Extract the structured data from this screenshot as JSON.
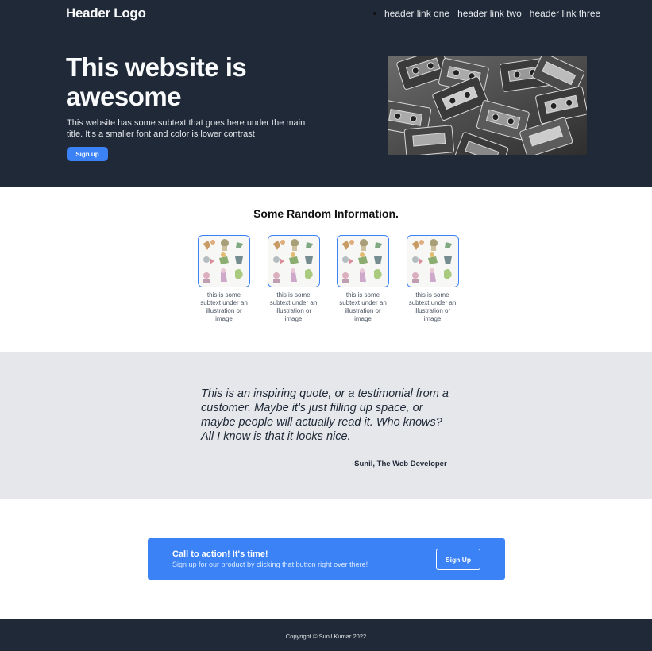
{
  "header": {
    "logo": "Header Logo",
    "nav": [
      "header link one",
      "header link two",
      "header link three"
    ]
  },
  "hero": {
    "title": "This website is awesome",
    "subtext": "This website has some subtext that goes here under the main title. It's a smaller font and color is lower contrast",
    "button_label": "Sign up",
    "image_icon": "cassette-tapes-photo"
  },
  "info": {
    "title": "Some Random Information.",
    "cards": [
      {
        "text": "this is some subtext under an illustration or image",
        "icon": "animals-illustration"
      },
      {
        "text": "this is some subtext under an illustration or image",
        "icon": "animals-illustration"
      },
      {
        "text": "this is some subtext under an illustration or image",
        "icon": "animals-illustration"
      },
      {
        "text": "this is some subtext under an illustration or image",
        "icon": "animals-illustration"
      }
    ]
  },
  "quote": {
    "text": "This is an inspiring quote, or a testimonial from a customer. Maybe it's just filling up space, or maybe people will actually read it. Who knows? All I know is that it looks nice.",
    "author": "-Sunil, The Web Developer"
  },
  "cta": {
    "title": "Call to action! It's time!",
    "subtext": "Sign up for our product by clicking that button right over there!",
    "button_label": "Sign Up"
  },
  "footer": {
    "copyright": "Copyright © Sunil Kumar 2022"
  },
  "colors": {
    "dark": "#1f2937",
    "accent": "#3b82f6",
    "quote_bg": "#e5e7eb"
  }
}
